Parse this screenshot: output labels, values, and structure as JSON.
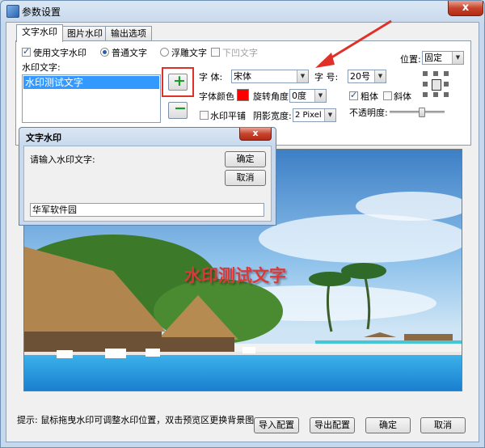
{
  "window": {
    "title": "参数设置",
    "close_glyph": "x"
  },
  "tabs": [
    "文字水印",
    "图片水印",
    "输出选项"
  ],
  "text_tab": {
    "use_text_watermark": "使用文字水印",
    "normal_text": "普通文字",
    "floating_text": "浮雕文字",
    "sunken_text": "下凹文字",
    "watermark_text_label": "水印文字:",
    "watermark_list": [
      "水印测试文字"
    ],
    "add_glyph": "+",
    "remove_glyph": "−",
    "font_label": "字  体:",
    "font_value": "宋体",
    "size_label": "字  号:",
    "size_value": "20号",
    "color_label": "字体颜色",
    "color_value": "#ff0000",
    "rotation_label": "旋转角度",
    "rotation_value": "0度",
    "bold_label": "粗体",
    "italic_label": "斜体",
    "tile_label": "水印平铺",
    "shadow_label": "阴影宽度:",
    "shadow_value": "2 Pixel",
    "opacity_label": "不透明度:",
    "opacity_level": 0.6,
    "position_label": "位置:",
    "position_value": "固定"
  },
  "dialog": {
    "title": "文字水印",
    "close_glyph": "x",
    "prompt": "请输入水印文字:",
    "ok": "确定",
    "cancel": "取消",
    "input_value": "华军软件园"
  },
  "preview": {
    "watermark_text": "水印测试文字",
    "watermark_color": "#d83a3a"
  },
  "footer": {
    "hint": "提示: 鼠标拖曳水印可调整水印位置，双击预览区更换背景图。",
    "import": "导入配置",
    "export": "导出配置",
    "ok": "确定",
    "cancel": "取消"
  }
}
